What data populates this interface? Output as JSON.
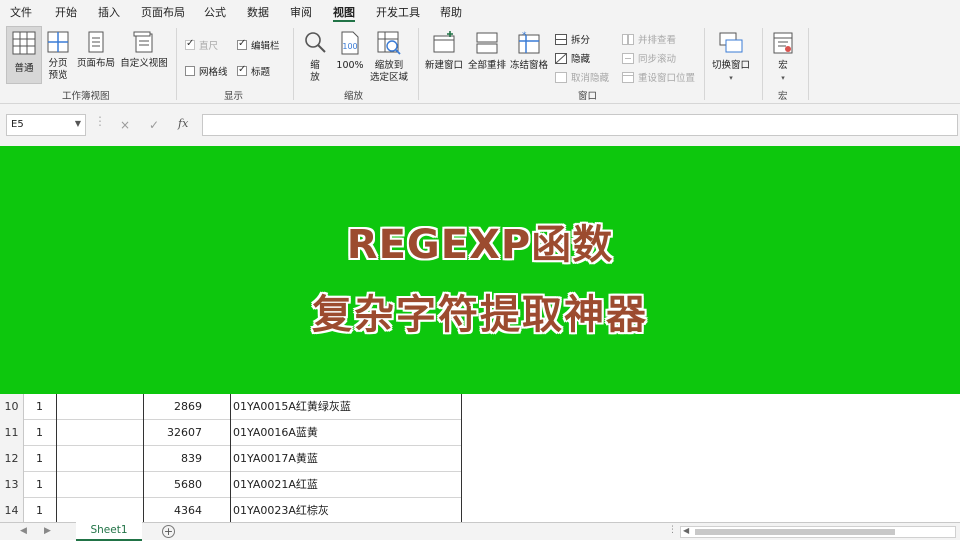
{
  "menu": {
    "items": [
      "文件",
      "开始",
      "插入",
      "页面布局",
      "公式",
      "数据",
      "审阅",
      "视图",
      "开发工具",
      "帮助"
    ],
    "active": "视图"
  },
  "ribbon": {
    "workbook_views": {
      "normal": "普通",
      "page_break_line1": "分页",
      "page_break_line2": "预览",
      "page_layout": "页面布局",
      "custom_views": "自定义视图",
      "group_label": "工作簿视图"
    },
    "show": {
      "ruler": "直尺",
      "formula_bar": "编辑栏",
      "gridlines": "网格线",
      "headings": "标题",
      "group_label": "显示",
      "ruler_checked": true,
      "formula_bar_checked": true,
      "gridlines_checked": false,
      "headings_checked": true
    },
    "zoom": {
      "zoom_line1": "缩",
      "zoom_line2": "放",
      "zoom100": "100%",
      "zoom_selection_line1": "缩放到",
      "zoom_selection_line2": "选定区域",
      "group_label": "缩放"
    },
    "window": {
      "new_window": "新建窗口",
      "arrange_all": "全部重排",
      "freeze_panes": "冻结窗格",
      "split": "拆分",
      "hide": "隐藏",
      "unhide": "取消隐藏",
      "side_by_side": "并排查看",
      "sync_scroll": "同步滚动",
      "reset_position": "重设窗口位置",
      "switch_windows": "切换窗口",
      "group_label": "窗口"
    },
    "macros": {
      "macros": "宏",
      "group_label": "宏"
    }
  },
  "formula_bar": {
    "name_box": "E5",
    "cancel": "×",
    "enter": "✓",
    "fx": "fx",
    "value": ""
  },
  "banner": {
    "line1": "REGEXP函数",
    "line2": "复杂字符提取神器",
    "background": "#0dc70d",
    "text_color": "#9c4b2f"
  },
  "rows": [
    {
      "num": "10",
      "a": "1",
      "b": "",
      "c": "2869",
      "d": "01YA0015A红黄绿灰蓝"
    },
    {
      "num": "11",
      "a": "1",
      "b": "",
      "c": "32607",
      "d": "01YA0016A蓝黄"
    },
    {
      "num": "12",
      "a": "1",
      "b": "",
      "c": "839",
      "d": "01YA0017A黄蓝"
    },
    {
      "num": "13",
      "a": "1",
      "b": "",
      "c": "5680",
      "d": "01YA0021A红蓝"
    },
    {
      "num": "14",
      "a": "1",
      "b": "",
      "c": "4364",
      "d": "01YA0023A红棕灰"
    }
  ],
  "sheets": {
    "active": "Sheet1",
    "add": "+"
  }
}
